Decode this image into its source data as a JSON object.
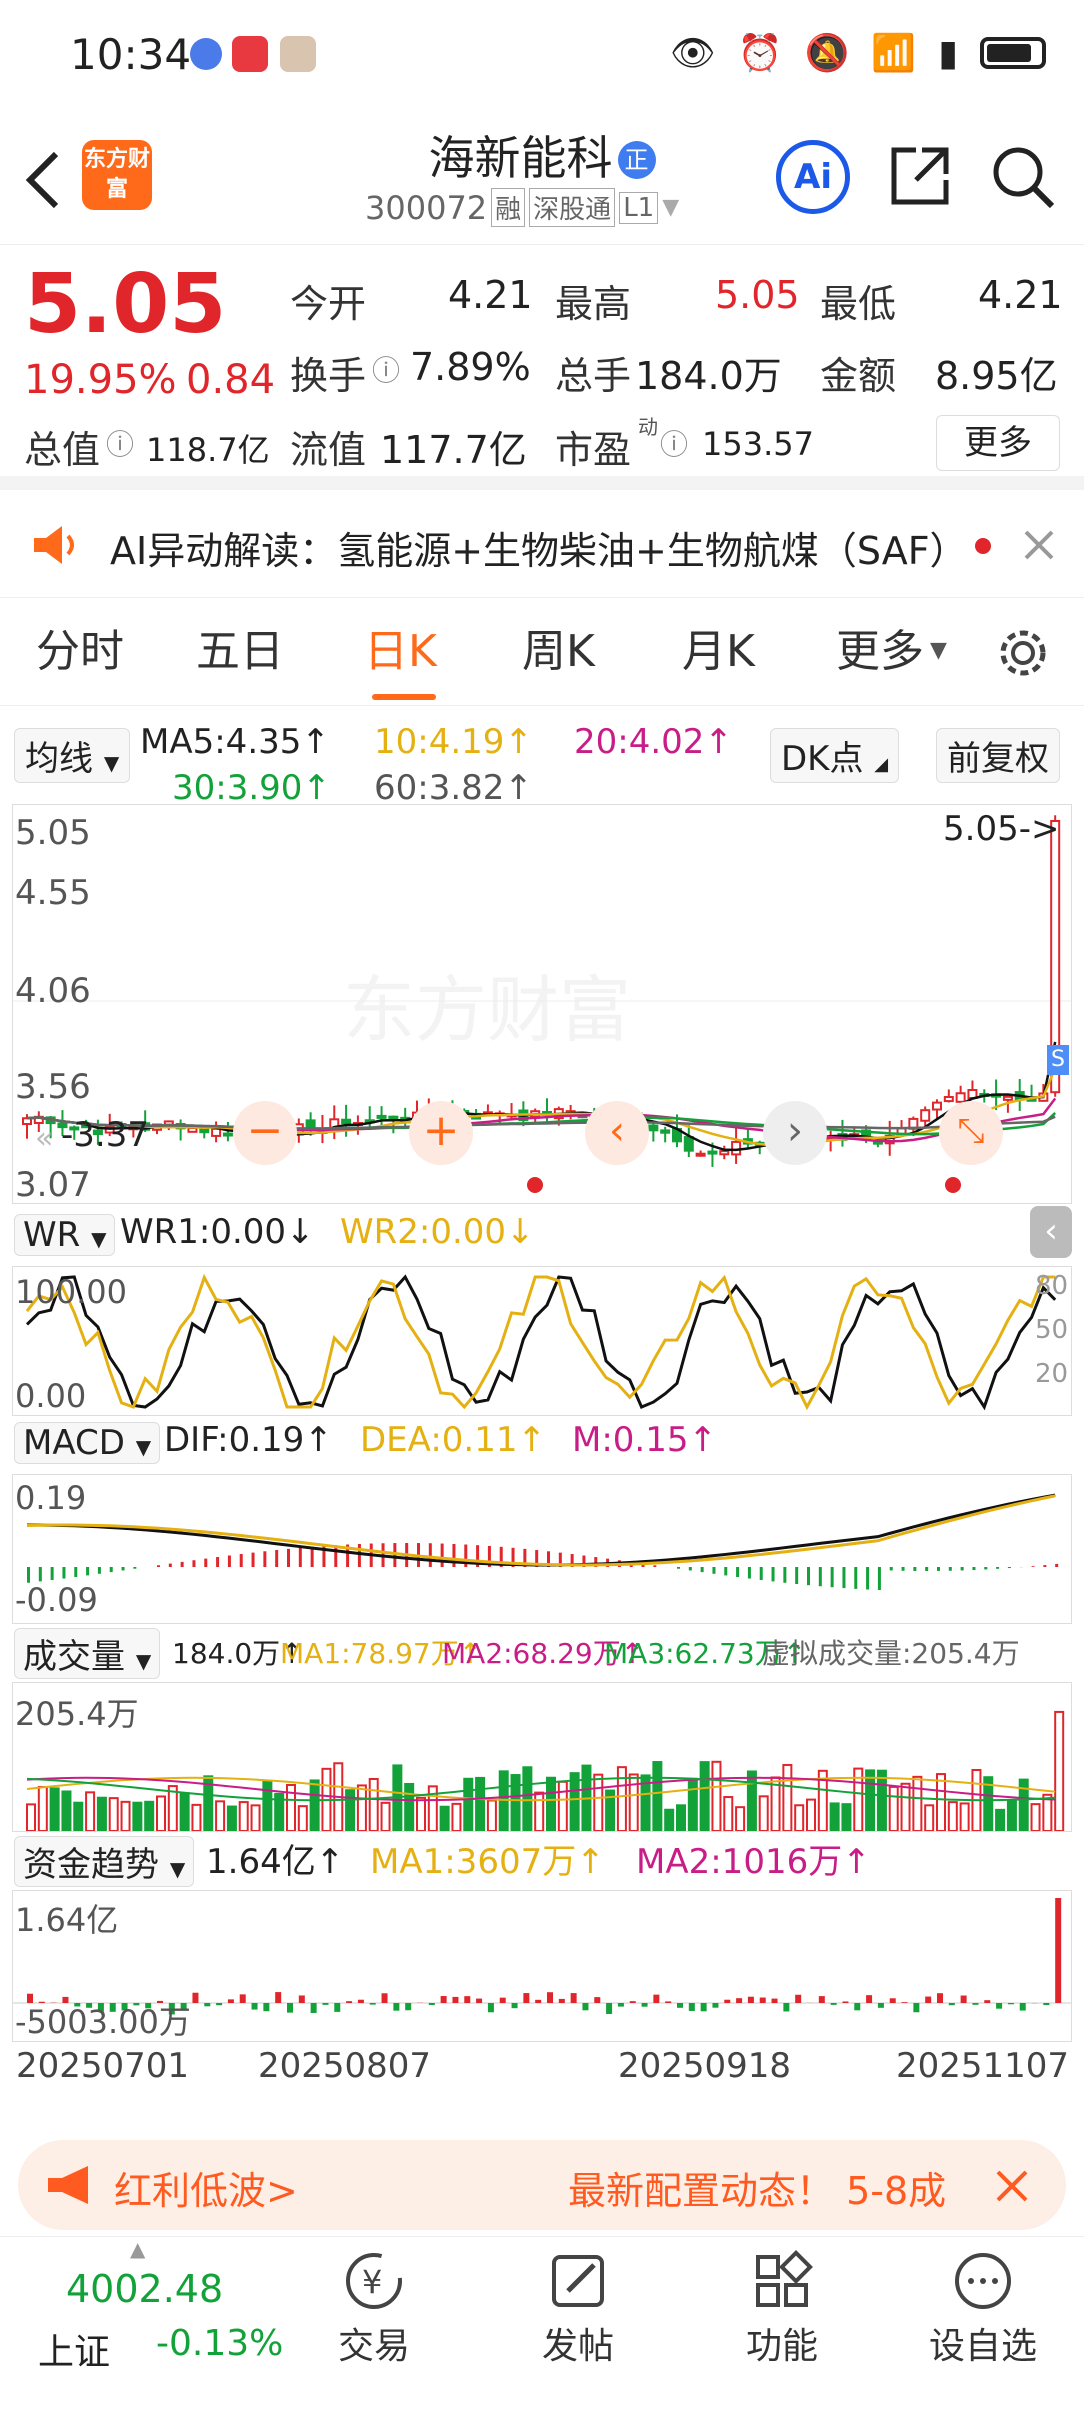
{
  "status": {
    "time": "10:34"
  },
  "header": {
    "title": "海新能科",
    "code": "300072",
    "tags": [
      "融",
      "深股通",
      "L1"
    ],
    "logo": "东方财富",
    "back_icon": "back-arrow-icon",
    "ai_label": "Ai"
  },
  "quote": {
    "price": "5.05",
    "pct": "19.95%",
    "chg": "0.84",
    "open_label": "今开",
    "open": "4.21",
    "high_label": "最高",
    "high": "5.05",
    "low_label": "最低",
    "low": "4.21",
    "turn_label": "换手",
    "turn": "7.89%",
    "vol_label": "总手",
    "vol": "184.0万",
    "amt_label": "金额",
    "amt": "8.95亿",
    "mcap_label": "总值",
    "mcap": "118.7亿",
    "fmcap_label": "流值",
    "fmcap": "117.7亿",
    "pe_label": "市盈",
    "pe_sup": "动",
    "pe": "153.57",
    "more": "更多"
  },
  "ai_bar": {
    "text": "AI异动解读：氢能源+生物柴油+生物航煤（SAF）"
  },
  "tabs": [
    "分时",
    "五日",
    "日K",
    "周K",
    "月K",
    "更多"
  ],
  "active_tab": "日K",
  "ma_row": {
    "select": "均线",
    "ma5": "MA5:4.35↑",
    "ma10": "10:4.19↑",
    "ma20": "20:4.02↑",
    "ma30": "30:3.90↑",
    "ma60": "60:3.82↑",
    "dk": "DK点",
    "fq": "前复权"
  },
  "kline": {
    "y_labels": [
      "5.05",
      "4.55",
      "4.06",
      "3.56",
      "3.07"
    ],
    "high_mark": "5.05->",
    "low_mark": "-3.37",
    "watermark": "东方财富",
    "s_badge": "S"
  },
  "wr": {
    "select": "WR",
    "wr1": "WR1:0.00↓",
    "wr2": "WR2:0.00↓",
    "y_left": [
      "100.00",
      "0.00"
    ],
    "y_right": [
      "80",
      "50",
      "20"
    ]
  },
  "macd": {
    "select": "MACD",
    "dif": "DIF:0.19↑",
    "dea": "DEA:0.11↑",
    "m": "M:0.15↑",
    "y_labels": [
      "0.19",
      "-0.09"
    ]
  },
  "volume": {
    "select": "成交量",
    "total": "184.0万↑",
    "ma1": "MA1:78.97万↑",
    "ma2": "MA2:68.29万↑",
    "ma3": "MA3:62.73万↑",
    "virtual": "虚拟成交量:205.4万",
    "y_label": "205.4万"
  },
  "fund": {
    "select": "资金趋势",
    "val": "1.64亿↑",
    "ma1": "MA1:3607万↑",
    "ma2": "MA2:1016万↑",
    "y_top": "1.64亿",
    "y_bot": "-5003.00万"
  },
  "dates": [
    "20250701",
    "20250807",
    "20250918",
    "20251107"
  ],
  "banner": {
    "left": "红利低波>",
    "right": "最新配置动态！ 5-8成",
    "icon": "megaphone-icon"
  },
  "bottom": {
    "index_val": "4002.48",
    "index_name": "上证",
    "index_chg": "-0.13%",
    "nav": [
      "交易",
      "发帖",
      "功能",
      "设自选"
    ]
  },
  "colors": {
    "up": "#e0262b",
    "down": "#13a23a",
    "accent": "#ff6a1a",
    "link": "#1c59e8"
  }
}
